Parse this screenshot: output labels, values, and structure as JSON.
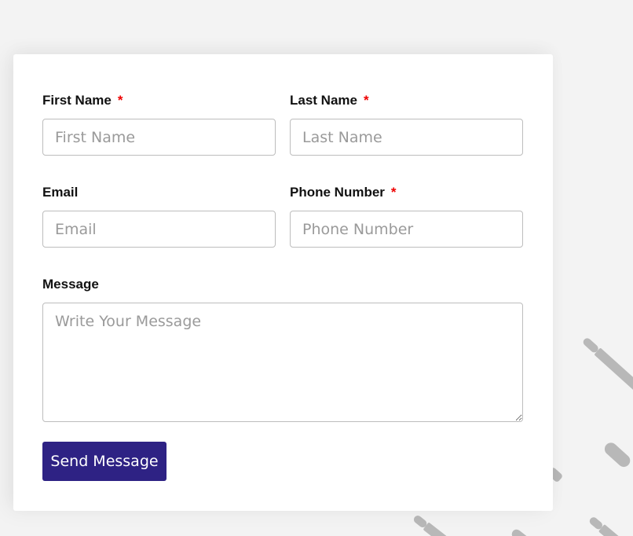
{
  "form": {
    "first_name": {
      "label": "First Name",
      "required_mark": "*",
      "placeholder": "First Name",
      "value": ""
    },
    "last_name": {
      "label": "Last Name",
      "required_mark": "*",
      "placeholder": "Last Name",
      "value": ""
    },
    "email": {
      "label": "Email",
      "placeholder": "Email",
      "value": ""
    },
    "phone": {
      "label": "Phone Number",
      "required_mark": "*",
      "placeholder": "Phone Number",
      "value": ""
    },
    "message": {
      "label": "Message",
      "placeholder": "Write Your Message",
      "value": ""
    },
    "submit_label": "Send Message"
  },
  "colors": {
    "page_background": "#f3f3f3",
    "card_background": "#ffffff",
    "button_background": "#2e2284",
    "required_mark": "#e00000",
    "decoration": "#b8b8b8"
  },
  "decorations": {
    "icon": "bullet-cartridge-icon"
  }
}
